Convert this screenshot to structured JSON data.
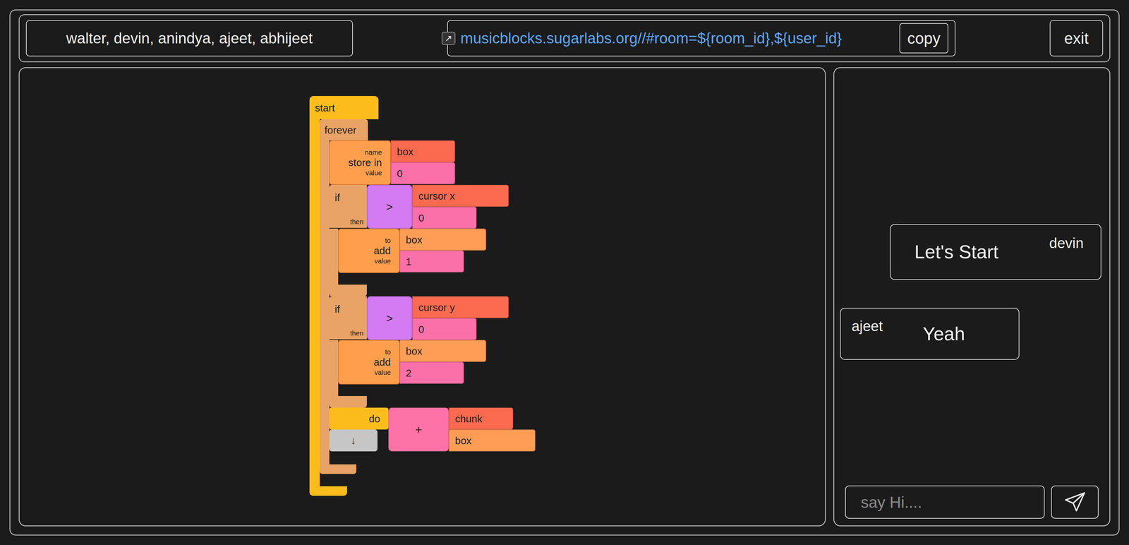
{
  "participants": "walter, devin, anindya, ajeet, abhijeet",
  "link": {
    "icon": "↗",
    "url": "musicblocks.sugarlabs.org//#room=${room_id},${user_id}",
    "copy": "copy"
  },
  "exit": "exit",
  "program": {
    "kind": "hat",
    "label": "start",
    "body": [
      {
        "kind": "loop",
        "label": "forever",
        "body": [
          {
            "kind": "command",
            "label": "store in",
            "args": [
              {
                "slot": "name",
                "arg": {
                  "kind": "name",
                  "text": "box"
                }
              },
              {
                "slot": "value",
                "arg": {
                  "kind": "number",
                  "text": "0"
                }
              }
            ]
          },
          {
            "kind": "if",
            "label": "if",
            "then": "then",
            "condition": {
              "kind": "compare",
              "op": ">",
              "args": [
                {
                  "kind": "sensor",
                  "text": "cursor x"
                },
                {
                  "kind": "number",
                  "text": "0"
                }
              ]
            },
            "body": [
              {
                "kind": "command",
                "label": "add",
                "args": [
                  {
                    "slot": "to",
                    "arg": {
                      "kind": "variable",
                      "text": "box"
                    }
                  },
                  {
                    "slot": "value",
                    "arg": {
                      "kind": "number",
                      "text": "1"
                    }
                  }
                ]
              }
            ]
          },
          {
            "kind": "if",
            "label": "if",
            "then": "then",
            "condition": {
              "kind": "compare",
              "op": ">",
              "args": [
                {
                  "kind": "sensor",
                  "text": "cursor y"
                },
                {
                  "kind": "number",
                  "text": "0"
                }
              ]
            },
            "body": [
              {
                "kind": "command",
                "label": "add",
                "args": [
                  {
                    "slot": "to",
                    "arg": {
                      "kind": "variable",
                      "text": "box"
                    }
                  },
                  {
                    "slot": "value",
                    "arg": {
                      "kind": "number",
                      "text": "2"
                    }
                  }
                ]
              }
            ]
          },
          {
            "kind": "do",
            "label": "do",
            "arg": {
              "kind": "plus",
              "op": "+",
              "args": [
                {
                  "kind": "name",
                  "text": "chunk"
                },
                {
                  "kind": "variable",
                  "text": "box"
                }
              ]
            }
          },
          {
            "kind": "arrow",
            "label": "↓"
          }
        ]
      }
    ]
  },
  "chat": {
    "messages": [
      {
        "user": "devin",
        "text": "Let's Start",
        "own": true
      },
      {
        "user": "ajeet",
        "text": "Yeah",
        "own": false
      }
    ],
    "input": {
      "placeholder": "say Hi...."
    }
  }
}
